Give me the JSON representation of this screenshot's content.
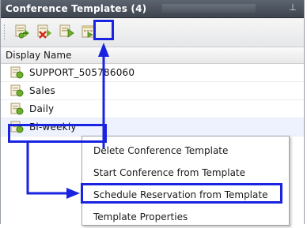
{
  "window": {
    "title": "Conference Templates (4)",
    "pin_glyph": "⊥"
  },
  "toolbar": {
    "buttons": [
      {
        "name": "new-template-button",
        "icon": "add-template-icon"
      },
      {
        "name": "delete-template-button",
        "icon": "delete-template-icon"
      },
      {
        "name": "start-conference-button",
        "icon": "start-conference-icon"
      },
      {
        "name": "schedule-reservation-button",
        "icon": "schedule-reservation-icon"
      }
    ]
  },
  "list": {
    "column_header": "Display Name",
    "rows": [
      {
        "label": "SUPPORT_505786060"
      },
      {
        "label": "Sales"
      },
      {
        "label": "Daily"
      },
      {
        "label": "Bi-weekly"
      }
    ]
  },
  "context_menu": {
    "items": [
      {
        "label": "Delete Conference Template"
      },
      {
        "label": "Start Conference from Template"
      },
      {
        "label": "Schedule Reservation from Template"
      },
      {
        "label": "Template Properties"
      }
    ]
  },
  "colors": {
    "accent_callout": "#1a24e0",
    "titlebar": "#4a515c",
    "icon_green": "#6fae2a",
    "icon_red": "#d22a1d"
  }
}
